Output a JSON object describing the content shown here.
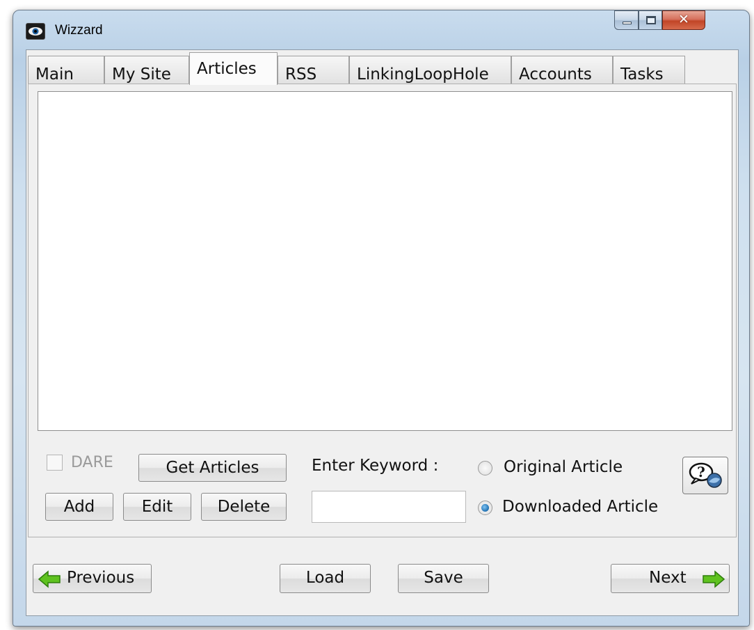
{
  "window": {
    "title": "Wizzard"
  },
  "tabs": [
    {
      "label": "Main"
    },
    {
      "label": "My Site"
    },
    {
      "label": "Articles"
    },
    {
      "label": "RSS"
    },
    {
      "label": "LinkingLoopHole"
    },
    {
      "label": "Accounts"
    },
    {
      "label": "Tasks"
    }
  ],
  "active_tab": "Articles",
  "articles": {
    "dare_label": "DARE",
    "dare_checked": false,
    "get_articles_label": "Get Articles",
    "add_label": "Add",
    "edit_label": "Edit",
    "delete_label": "Delete",
    "keyword_label": "Enter Keyword :",
    "keyword_value": "",
    "radio_original_label": "Original Article",
    "radio_downloaded_label": "Downloaded Article",
    "selected_source": "Downloaded Article"
  },
  "footer": {
    "previous_label": "Previous",
    "load_label": "Load",
    "save_label": "Save",
    "next_label": "Next"
  },
  "icons": {
    "app": "eye-icon",
    "help": "help-icon",
    "previous": "arrow-left-icon",
    "next": "arrow-right-icon"
  },
  "colors": {
    "arrow_green": "#5fc21f",
    "radio_selected": "#1f6fb0",
    "close_red": "#c14527"
  }
}
